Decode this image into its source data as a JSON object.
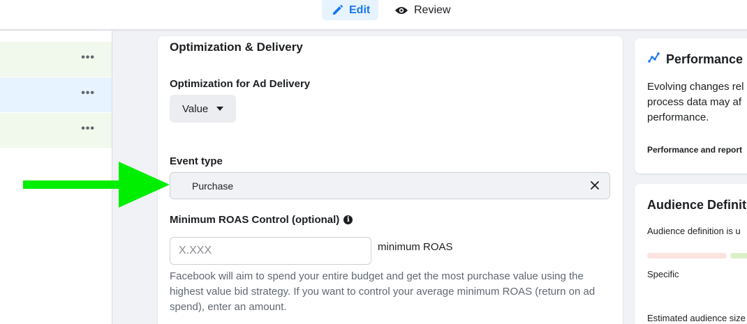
{
  "tabs": {
    "edit": "Edit",
    "review": "Review"
  },
  "left_panel": {
    "rows": [
      {
        "dots": "•••"
      },
      {
        "dots": "•••"
      },
      {
        "dots": "•••"
      }
    ]
  },
  "main": {
    "section_title": "Optimization & Delivery",
    "optimization_label": "Optimization for Ad Delivery",
    "optimization_value": "Value",
    "event_type_label": "Event type",
    "event_type_value": "Purchase",
    "roas_label": "Minimum ROAS Control (optional)",
    "roas_placeholder": "X.XXX",
    "roas_suffix": "minimum ROAS",
    "help_text": "Facebook will aim to spend your entire budget and get the most purchase value using the highest value bid strategy. If you want to control your average minimum ROAS (return on ad spend), enter an amount."
  },
  "performance_card": {
    "title": "Performance m",
    "body": "Evolving changes rel process data may af performance.",
    "footer": "Performance and report"
  },
  "audience_card": {
    "title": "Audience Definitio",
    "subtitle": "Audience definition is u",
    "specific_label": "Specific",
    "estimated_label": "Estimated audience size"
  },
  "colors": {
    "accent": "#1877f2",
    "arrow": "#00ee00",
    "row_green": "#f1f8ec",
    "row_blue": "#e7f3ff",
    "bar_red": "#fbe3df",
    "bar_green": "#dcf0c8"
  }
}
